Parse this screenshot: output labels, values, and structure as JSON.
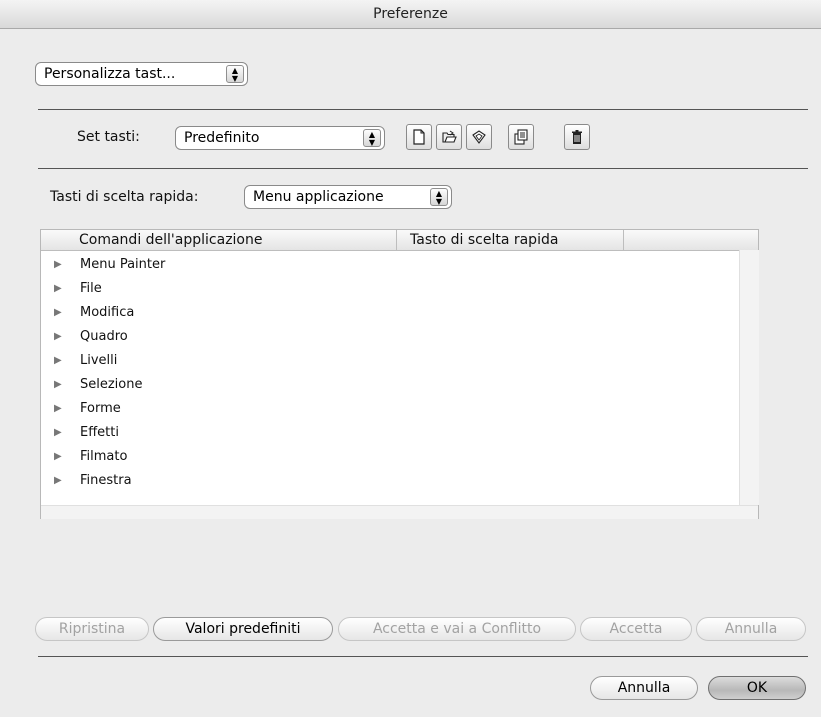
{
  "window": {
    "title": "Preferenze"
  },
  "section_popup": {
    "value": "Personalizza tast..."
  },
  "keyset": {
    "label": "Set tasti:",
    "value": "Predefinito",
    "icons": [
      "new-document-icon",
      "open-folder-icon",
      "save-icon",
      "duplicate-icon",
      "trash-icon"
    ]
  },
  "shortcuts": {
    "label": "Tasti di scelta rapida:",
    "value": "Menu applicazione"
  },
  "table": {
    "columns": [
      "Comandi dell'applicazione",
      "Tasto di scelta rapida"
    ],
    "rows": [
      "Menu Painter",
      "File",
      "Modifica",
      "Quadro",
      "Livelli",
      "Selezione",
      "Forme",
      "Effetti",
      "Filmato",
      "Finestra"
    ]
  },
  "action_buttons": {
    "ripristina": "Ripristina",
    "valori_predefiniti": "Valori predefiniti",
    "accetta_conflitto": "Accetta e vai a Conflitto",
    "accetta": "Accetta",
    "annulla": "Annulla"
  },
  "dialog_buttons": {
    "cancel": "Annulla",
    "ok": "OK"
  }
}
